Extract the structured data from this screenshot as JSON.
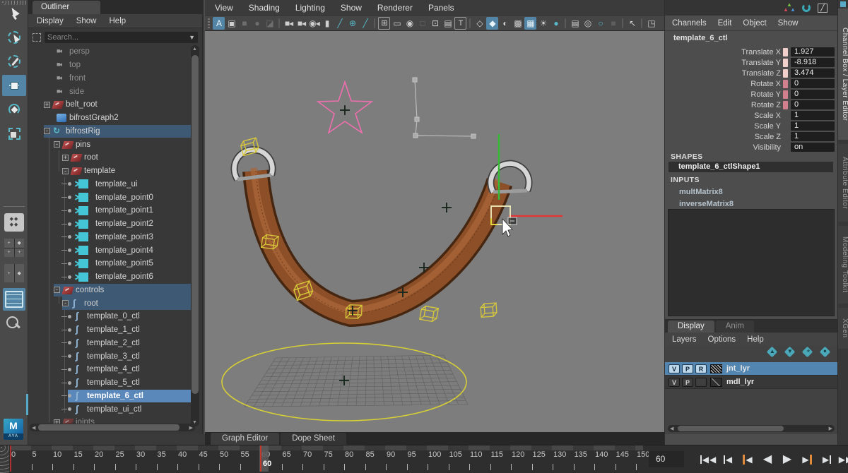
{
  "toolbox": {
    "tools": [
      {
        "name": "select-tool",
        "icon": "ti-select"
      },
      {
        "name": "lasso-tool",
        "icon": "ti-lasso"
      },
      {
        "name": "paint-select-tool",
        "icon": "ti-paint"
      },
      {
        "name": "move-tool",
        "icon": "ti-move",
        "cls": "active"
      },
      {
        "name": "rotate-tool",
        "icon": "ti-rotate"
      },
      {
        "name": "scale-tool",
        "icon": "ti-scale"
      }
    ],
    "layouts": [
      {
        "name": "single-pane-layout",
        "icon": "li-single",
        "glyph": "◆◆\n◆◆"
      },
      {
        "name": "four-pane-layout",
        "icon": "li-four"
      },
      {
        "name": "two-pane-layout",
        "icon": "li-two"
      },
      {
        "name": "outliner-persp-layout",
        "icon": "li-outl",
        "cls": "active"
      }
    ],
    "logo_m": "M",
    "logo_sub": "AYA"
  },
  "outliner": {
    "tab": "Outliner",
    "menus": [
      "Display",
      "Show",
      "Help"
    ],
    "search_placeholder": "Search...",
    "items": [
      {
        "label": "persp",
        "x": 40,
        "icon": "ico-camera",
        "txt": "txt-dim"
      },
      {
        "label": "top",
        "x": 40,
        "icon": "ico-camera",
        "txt": "txt-dim"
      },
      {
        "label": "front",
        "x": 40,
        "icon": "ico-camera",
        "txt": "txt-dim"
      },
      {
        "label": "side",
        "x": 40,
        "icon": "ico-camera",
        "txt": "txt-dim"
      },
      {
        "label": "belt_root",
        "x": 22,
        "expand": "+",
        "icon": "ico-xform"
      },
      {
        "label": "bifrostGraph2",
        "x": 40,
        "icon": "ico-bifrost"
      },
      {
        "label": "bifrostRig",
        "x": 22,
        "expand": "-",
        "icon": "ico-rig",
        "sel": "sel-dim"
      },
      {
        "label": "pins",
        "x": 36,
        "expand": "-",
        "icon": "ico-xform"
      },
      {
        "label": "root",
        "x": 48,
        "expand": "+",
        "icon": "ico-xform"
      },
      {
        "label": "template",
        "x": 48,
        "expand": "-",
        "icon": "ico-xform"
      },
      {
        "label": "template_ui",
        "x": 56,
        "bullet": true,
        "icon": "ico-star"
      },
      {
        "label": "template_point0",
        "x": 56,
        "bullet": true,
        "icon": "ico-star"
      },
      {
        "label": "template_point1",
        "x": 56,
        "bullet": true,
        "icon": "ico-star"
      },
      {
        "label": "template_point2",
        "x": 56,
        "bullet": true,
        "icon": "ico-star"
      },
      {
        "label": "template_point3",
        "x": 56,
        "bullet": true,
        "icon": "ico-star"
      },
      {
        "label": "template_point4",
        "x": 56,
        "bullet": true,
        "icon": "ico-star"
      },
      {
        "label": "template_point5",
        "x": 56,
        "bullet": true,
        "icon": "ico-star"
      },
      {
        "label": "template_point6",
        "x": 56,
        "bullet": true,
        "icon": "ico-star"
      },
      {
        "label": "controls",
        "x": 36,
        "expand": "-",
        "icon": "ico-xform",
        "sel": "sel-dim"
      },
      {
        "label": "root",
        "x": 48,
        "expand": "-",
        "icon": "ico-curve",
        "sel": "sel-dim"
      },
      {
        "label": "template_0_ctl",
        "x": 56,
        "bullet": true,
        "icon": "ico-curve"
      },
      {
        "label": "template_1_ctl",
        "x": 56,
        "bullet": true,
        "icon": "ico-curve"
      },
      {
        "label": "template_2_ctl",
        "x": 56,
        "bullet": true,
        "icon": "ico-curve"
      },
      {
        "label": "template_3_ctl",
        "x": 56,
        "bullet": true,
        "icon": "ico-curve"
      },
      {
        "label": "template_4_ctl",
        "x": 56,
        "bullet": true,
        "icon": "ico-curve"
      },
      {
        "label": "template_5_ctl",
        "x": 56,
        "bullet": true,
        "icon": "ico-curve"
      },
      {
        "label": "template_6_ctl",
        "x": 56,
        "bullet": true,
        "icon": "ico-curve",
        "sel": "sel-bright"
      },
      {
        "label": "template_ui_ctl",
        "x": 56,
        "bullet": true,
        "icon": "ico-curve"
      },
      {
        "label": "joints",
        "x": 36,
        "expand": "+",
        "icon": "ico-xform-dim",
        "txt": "txt-dim"
      }
    ]
  },
  "viewport": {
    "menus": [
      "View",
      "Shading",
      "Lighting",
      "Show",
      "Renderer",
      "Panels"
    ],
    "icons": [
      {
        "n": "toolbar-grip",
        "c": "grip"
      },
      {
        "n": "select-camera-icon",
        "g": "A",
        "c": "act"
      },
      {
        "n": "selection-mask-icon",
        "g": "▣",
        "c": "lit"
      },
      {
        "n": "snap-icon",
        "g": "■",
        "c": "dim"
      },
      {
        "n": "snap-point-icon",
        "g": "●",
        "c": "dim"
      },
      {
        "n": "snap-plane-icon",
        "g": "◪",
        "c": "dim"
      },
      {
        "n": "separator",
        "c": "sep"
      },
      {
        "n": "camera-icon",
        "g": "■◂",
        "c": "lit"
      },
      {
        "n": "camera-lock-icon",
        "g": "■◂",
        "c": "lit"
      },
      {
        "n": "camera-attributes-icon",
        "g": "◉◂",
        "c": "lit"
      },
      {
        "n": "bookmark-icon",
        "g": "▮",
        "c": "lit"
      },
      {
        "n": "brush-icon",
        "g": "╱",
        "c": "teal"
      },
      {
        "n": "pan-zoom-icon",
        "g": "⊕",
        "c": "teal"
      },
      {
        "n": "pencil-icon",
        "g": "╱",
        "c": "teal"
      },
      {
        "n": "separator",
        "c": "sep"
      },
      {
        "n": "grid-icon",
        "g": "⊞",
        "c": "framed"
      },
      {
        "n": "film-gate-icon",
        "g": "▭",
        "c": "lit"
      },
      {
        "n": "resolution-gate-icon",
        "g": "◉",
        "c": "lit"
      },
      {
        "n": "gate-mask-icon",
        "g": "□",
        "c": "dim"
      },
      {
        "n": "field-chart-icon",
        "g": "⊡",
        "c": "lit"
      },
      {
        "n": "image-plane-icon",
        "g": "▤",
        "c": "lit"
      },
      {
        "n": "hud-icon",
        "g": "T",
        "c": "framed"
      },
      {
        "n": "separator",
        "c": "sep"
      },
      {
        "n": "wireframe-icon",
        "g": "◇",
        "c": "lit"
      },
      {
        "n": "shaded-mode-icon",
        "g": "◆",
        "c": "actb"
      },
      {
        "n": "material-icon",
        "g": "◐",
        "c": "lit"
      },
      {
        "n": "textured-icon",
        "g": "▩",
        "c": "lit"
      },
      {
        "n": "checker-icon",
        "g": "▦",
        "c": "actb"
      },
      {
        "n": "lights-icon",
        "g": "☀",
        "c": "lit"
      },
      {
        "n": "paint-effects-icon",
        "g": "●",
        "c": "teal"
      },
      {
        "n": "separator",
        "c": "sep"
      },
      {
        "n": "xray-icon",
        "g": "▤",
        "c": "lit"
      },
      {
        "n": "exposure-icon",
        "g": "◎",
        "c": "lit"
      },
      {
        "n": "gamma-icon",
        "g": "○",
        "c": "teal"
      },
      {
        "n": "plain-icon",
        "g": "■",
        "c": "dimf"
      },
      {
        "n": "separator",
        "c": "sep"
      },
      {
        "n": "select-through-icon",
        "g": "↖",
        "c": "lit"
      },
      {
        "n": "separator",
        "c": "sep"
      },
      {
        "n": "isolate-select-icon",
        "g": "◳",
        "c": "lit"
      }
    ],
    "tabs": [
      "Graph Editor",
      "Dope Sheet"
    ]
  },
  "channel_box": {
    "menus": [
      "Channels",
      "Edit",
      "Object",
      "Show"
    ],
    "object": "template_6_ctl",
    "attributes": [
      {
        "label": "Translate X",
        "value": "1.927",
        "sw": "sw-key"
      },
      {
        "label": "Translate Y",
        "value": "-8.918",
        "sw": "sw-key"
      },
      {
        "label": "Translate Z",
        "value": "3.474",
        "sw": "sw-key"
      },
      {
        "label": "Rotate X",
        "value": "0",
        "sw": "sw-rot"
      },
      {
        "label": "Rotate Y",
        "value": "0",
        "sw": "sw-rot"
      },
      {
        "label": "Rotate Z",
        "value": "0",
        "sw": "sw-rot"
      },
      {
        "label": "Scale X",
        "value": "1"
      },
      {
        "label": "Scale Y",
        "value": "1"
      },
      {
        "label": "Scale Z",
        "value": "1"
      },
      {
        "label": "Visibility",
        "value": "on"
      }
    ],
    "shapes_header": "SHAPES",
    "shape_name": "template_6_ctlShape1",
    "inputs_header": "INPUTS",
    "inputs": [
      "multMatrix8",
      "inverseMatrix8"
    ]
  },
  "layer_panel": {
    "tabs": [
      {
        "label": "Display",
        "cls": "active"
      },
      {
        "label": "Anim"
      }
    ],
    "menus": [
      "Layers",
      "Options",
      "Help"
    ],
    "icon_names": [
      "layer-up-icon",
      "layer-down-icon",
      "new-empty-layer-icon",
      "new-layer-from-selected-icon"
    ],
    "layers": [
      {
        "name": "jnt_lyr",
        "t1": "V",
        "t2": "P",
        "t3": "R",
        "swatch": "hatch",
        "cls": "selected"
      },
      {
        "name": "mdl_lyr",
        "t1": "V",
        "t2": "P",
        "t3": "",
        "swatch": "line"
      }
    ]
  },
  "side_tabs": [
    {
      "label": "Channel Box / Layer Editor",
      "cls": "active"
    },
    {
      "label": "Attribute Editor"
    },
    {
      "label": "Modeling Toolkit"
    },
    {
      "label": "XGen"
    }
  ],
  "top_icons": [
    "snap-axis-icon",
    "performance-gauge-icon",
    "profiler-chart-icon"
  ],
  "timeline": {
    "labels": [
      "0",
      "5",
      "10",
      "15",
      "20",
      "25",
      "30",
      "35",
      "40",
      "45",
      "50",
      "55",
      "60",
      "65",
      "70",
      "75",
      "80",
      "85",
      "90",
      "95",
      "100",
      "105",
      "110",
      "115",
      "120",
      "125",
      "130",
      "135",
      "140",
      "145",
      "150"
    ],
    "step": 5,
    "current": 60,
    "current_label": "60",
    "key_frame": 0,
    "field_value": "60",
    "playback": [
      "go-to-start",
      "step-back-frame",
      "step-back-key",
      "play-backwards",
      "play-forwards",
      "step-forward-key",
      "step-forward-frame",
      "go-to-end"
    ]
  }
}
